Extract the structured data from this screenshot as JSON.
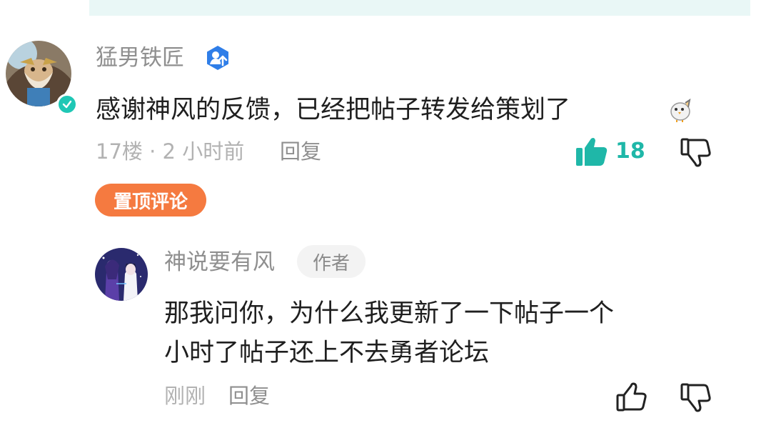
{
  "main_comment": {
    "username": "猛男铁匠",
    "badge_icon": "official-user-badge-icon",
    "text": "感谢神风的反馈，已经把帖子转发给策划了",
    "emoji_icon": "bird-emoji-icon",
    "floor_time": "17楼 · 2 小时前",
    "reply_label": "回复",
    "like_count": "18",
    "pin_label": "置顶评论"
  },
  "reply": {
    "username": "神说要有风",
    "author_label": "作者",
    "text_line1": "那我问你，为什么我更新了一下帖子一个",
    "text_line2": "小时了帖子还上不去勇者论坛",
    "time": "刚刚",
    "reply_label": "回复"
  },
  "colors": {
    "accent": "#1fb7a8",
    "pin": "#f57a40",
    "muted": "#b2b2b2",
    "top_strip": "#e9f7f6"
  }
}
